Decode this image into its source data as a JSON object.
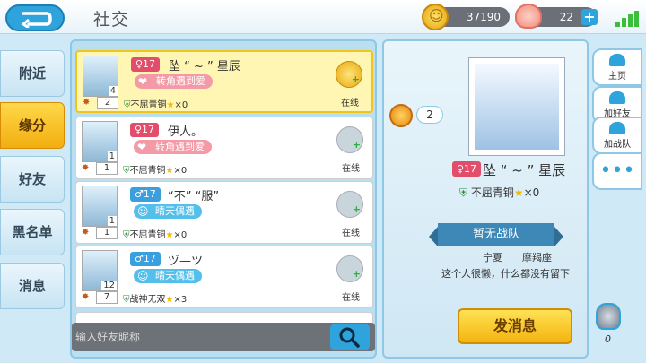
{
  "app": {
    "title": "社交"
  },
  "currency": {
    "coins": "37190",
    "shells": "22",
    "plus": "+"
  },
  "tabs": [
    {
      "label": "附近",
      "active": false
    },
    {
      "label": "缘分",
      "active": true
    },
    {
      "label": "好友",
      "active": false
    },
    {
      "label": "黑名单",
      "active": false
    },
    {
      "label": "消息",
      "active": false
    }
  ],
  "list": [
    {
      "gender": "♀17",
      "name": "坠 “ ~ ” 星辰",
      "tag": "转角遇到爱",
      "tag_type": "love",
      "avatar_level": "4",
      "medal": "2",
      "rank": "不屈青铜",
      "stars": "×0",
      "status": "在线",
      "selected": true
    },
    {
      "gender": "♀17",
      "name": "伊人。",
      "tag": "转角遇到爱",
      "tag_type": "love",
      "avatar_level": "1",
      "medal": "1",
      "rank": "不屈青铜",
      "stars": "×0",
      "status": "在线",
      "selected": false
    },
    {
      "gender": "♂17",
      "name": "“不” “服”",
      "tag": "晴天偶遇",
      "tag_type": "sunny",
      "avatar_level": "1",
      "medal": "1",
      "rank": "不屈青铜",
      "stars": "×0",
      "status": "在线",
      "selected": false
    },
    {
      "gender": "♂17",
      "name": "ヅ—ツ",
      "tag": "晴天偶遇",
      "tag_type": "sunny",
      "avatar_level": "12",
      "medal": "7",
      "rank": "战神无双",
      "stars": "×3",
      "status": "在线",
      "selected": false
    }
  ],
  "search": {
    "placeholder": "输入好友昵称"
  },
  "detail": {
    "gender": "♀17",
    "name": "坠 “ ~ ” 星辰",
    "medal": "2",
    "rank": "不屈青铜",
    "stars": "×0",
    "team": "暂无战队",
    "location": "宁夏",
    "zodiac": "摩羯座",
    "bio": "这个人很懒，什么都没有留下",
    "send_label": "发消息"
  },
  "side_buttons": [
    {
      "label": "主页",
      "icon": "home-icon"
    },
    {
      "label": "加好友",
      "icon": "add-friend-icon"
    },
    {
      "label": "加战队",
      "icon": "add-team-icon"
    }
  ],
  "helmet_count": "0",
  "colors": {
    "accent": "#2fa3dc",
    "selected": "#fff6b3",
    "gold": "#f4b40e"
  }
}
